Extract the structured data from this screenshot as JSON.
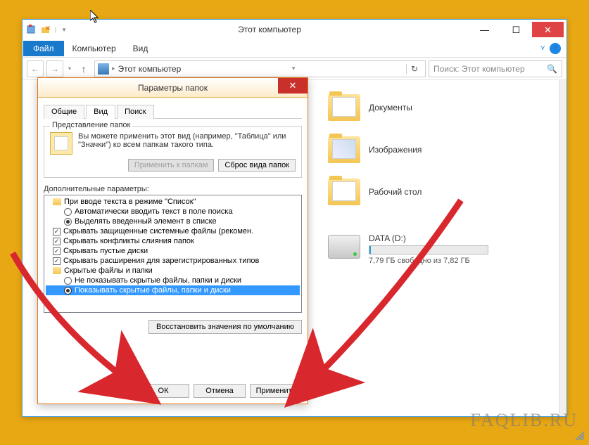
{
  "explorer": {
    "title": "Этот компьютер",
    "menu": {
      "file": "Файл",
      "computer": "Компьютер",
      "view": "Вид"
    },
    "address": "Этот компьютер",
    "search_placeholder": "Поиск: Этот компьютер",
    "folders": {
      "documents": "Документы",
      "pictures": "Изображения",
      "desktop": "Рабочий стол"
    },
    "drive": {
      "name": "DATA (D:)",
      "free_text": "7,79 ГБ свободно из 7,82 ГБ"
    }
  },
  "dialog": {
    "title": "Параметры папок",
    "tabs": {
      "general": "Общие",
      "view": "Вид",
      "search": "Поиск"
    },
    "group": {
      "title": "Представление папок",
      "desc": "Вы можете применить этот вид (например, \"Таблица\" или \"Значки\") ко всем папкам такого типа.",
      "apply": "Применить к папкам",
      "reset": "Сброс вида папок"
    },
    "advanced_label": "Дополнительные параметры:",
    "tree": {
      "list_mode": "При вводе текста в режиме \"Список\"",
      "auto_search": "Автоматически вводить текст в поле поиска",
      "highlight": "Выделять введенный элемент в списке",
      "hide_protected": "Скрывать защищенные системные файлы (рекомен.",
      "hide_merge": "Скрывать конфликты слияния папок",
      "hide_empty": "Скрывать пустые диски",
      "hide_ext": "Скрывать расширения для зарегистрированных типов",
      "hidden_files": "Скрытые файлы и папки",
      "dont_show": "Не показывать скрытые файлы, папки и диски",
      "show": "Показывать скрытые файлы, папки и диски"
    },
    "restore": "Восстановить значения по умолчанию",
    "buttons": {
      "ok": "ОК",
      "cancel": "Отмена",
      "apply": "Применить"
    }
  },
  "watermark": "FAQLIB.RU"
}
